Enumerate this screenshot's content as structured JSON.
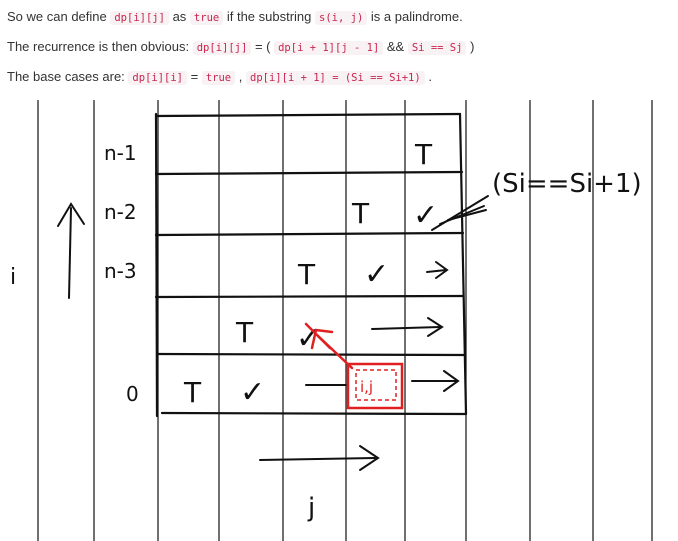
{
  "text": {
    "line1": {
      "a": "So we can define",
      "code1": "dp[i][j]",
      "b": "as",
      "code2": "true",
      "c": "if the substring",
      "code3": "s(i, j)",
      "d": "is a palindrome."
    },
    "line2": {
      "a": "The recurrence is then obvious:",
      "code1": "dp[i][j]",
      "b": "= (",
      "code2": "dp[i + 1][j - 1]",
      "c": "&&",
      "code3": "Si == Sj",
      "d": ")"
    },
    "line3": {
      "a": "The base cases are:",
      "code1": "dp[i][i]",
      "b": "=",
      "code2": "true",
      "c": ",",
      "code3": "dp[i][i + 1] = (Si == Si+1)",
      "d": "."
    }
  },
  "sketch": {
    "row_labels": [
      "n-1",
      "n-2",
      "n-3",
      "0"
    ],
    "axis_i": "i",
    "axis_j": "j",
    "cell_t": "T",
    "cell_check": "✓",
    "cell_ij": "i,j",
    "annotation": "(Si==Si+1)",
    "ink_color": "#111111",
    "red_color": "#e02020"
  }
}
